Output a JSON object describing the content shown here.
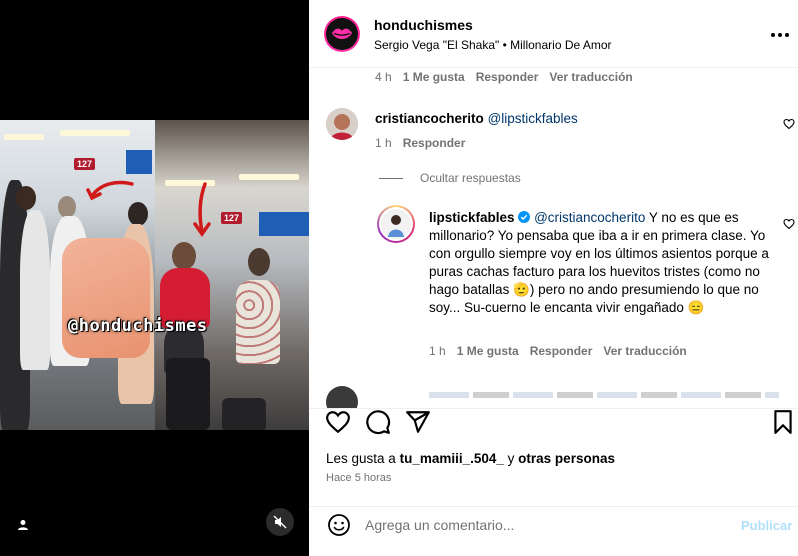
{
  "post": {
    "username": "honduchismes",
    "audio": "Sergio Vega \"El Shaka\" • Millonario De Amor",
    "photo_watermark": "@honduchismes",
    "photo_signs": [
      "127",
      "127"
    ]
  },
  "comments": {
    "previous_meta": {
      "time": "4 h",
      "likes": "1 Me gusta",
      "reply": "Responder",
      "translate": "Ver traducción"
    },
    "comment1": {
      "username": "cristiancocherito",
      "mention": "@lipstickfables",
      "time": "1 h",
      "reply": "Responder"
    },
    "hide_replies": "Ocultar respuestas",
    "reply1": {
      "username": "lipstickfables",
      "mention": "@cristiancocherito",
      "text": "Y no es que es millonario? Yo pensaba que iba a ir en primera clase. Yo con orgullo siempre voy en los últimos asientos porque a puras cachas facturo para los huevitos tristes (como no hago batallas 🫡) pero no ando presumiendo lo que no soy... Su-cuerno le encanta vivir engañado 😑",
      "time": "1 h",
      "likes": "1 Me gusta",
      "reply": "Responder",
      "translate": "Ver traducción"
    }
  },
  "footer": {
    "likes_prefix": "Les gusta a",
    "likes_user": "tu_mamiii_.504_",
    "likes_suffix": "y",
    "likes_others": "otras personas",
    "time_ago": "Hace 5 horas",
    "comment_placeholder": "Agrega un comentario...",
    "publish_label": "Publicar"
  },
  "colors": {
    "verified": "#0095f6",
    "link": "#00376b",
    "muted": "#737373",
    "publish_disabled": "#b2dffc"
  },
  "icons": [
    "user-tag-icon",
    "mute-icon",
    "more-icon",
    "heart-icon",
    "comment-icon",
    "share-icon",
    "bookmark-icon",
    "emoji-icon",
    "verified-badge-icon"
  ]
}
